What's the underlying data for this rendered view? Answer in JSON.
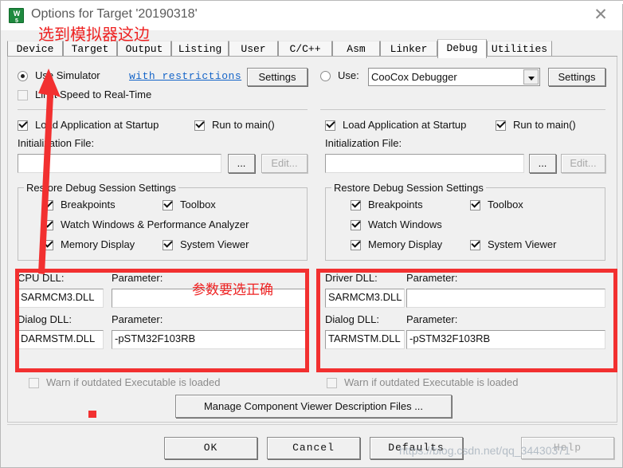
{
  "window": {
    "title": "Options for Target '20190318'",
    "icon": "uvision-icon",
    "close_label": "✕"
  },
  "tabs": [
    {
      "label": "Device",
      "selected": false
    },
    {
      "label": "Target",
      "selected": false
    },
    {
      "label": "Output",
      "selected": false
    },
    {
      "label": "Listing",
      "selected": false
    },
    {
      "label": "User",
      "selected": false
    },
    {
      "label": "C/C++",
      "selected": false
    },
    {
      "label": "Asm",
      "selected": false
    },
    {
      "label": "Linker",
      "selected": false
    },
    {
      "label": "Debug",
      "selected": true
    },
    {
      "label": "Utilities",
      "selected": false
    }
  ],
  "left_panel": {
    "use_simulator_label": "Use Simulator",
    "use_simulator_checked": true,
    "with_restrictions_link": "with restrictions",
    "settings_button": "Settings",
    "limit_speed_label": "Limit Speed to Real-Time",
    "limit_speed_checked": false,
    "load_app_label": "Load Application at Startup",
    "load_app_checked": true,
    "run_to_main_label": "Run to main()",
    "run_to_main_checked": true,
    "init_file_label": "Initialization File:",
    "init_file_value": "",
    "browse_button": "...",
    "edit_button": "Edit...",
    "restore_group_label": "Restore Debug Session Settings",
    "restore_items": [
      {
        "label": "Breakpoints",
        "checked": true
      },
      {
        "label": "Toolbox",
        "checked": true
      },
      {
        "label": "Watch Windows & Performance Analyzer",
        "checked": true
      },
      {
        "label": "Memory Display",
        "checked": true
      },
      {
        "label": "System Viewer",
        "checked": true
      }
    ],
    "cpu_dll_label": "CPU DLL:",
    "cpu_dll_value": "SARMCM3.DLL",
    "cpu_param_label": "Parameter:",
    "cpu_param_value": "",
    "dialog_dll_label": "Dialog DLL:",
    "dialog_dll_value": "DARMSTM.DLL",
    "dialog_param_label": "Parameter:",
    "dialog_param_value": "-pSTM32F103RB",
    "warn_outdated_label": "Warn if outdated Executable is loaded",
    "warn_outdated_checked": false
  },
  "right_panel": {
    "use_label": "Use:",
    "use_checked": false,
    "debugger_selected": "CooCox Debugger",
    "settings_button": "Settings",
    "load_app_label": "Load Application at Startup",
    "load_app_checked": true,
    "run_to_main_label": "Run to main()",
    "run_to_main_checked": true,
    "init_file_label": "Initialization File:",
    "init_file_value": "",
    "browse_button": "...",
    "edit_button": "Edit...",
    "restore_group_label": "Restore Debug Session Settings",
    "restore_items": [
      {
        "label": "Breakpoints",
        "checked": true
      },
      {
        "label": "Toolbox",
        "checked": true
      },
      {
        "label": "Watch Windows",
        "checked": true
      },
      {
        "label": "Memory Display",
        "checked": true
      },
      {
        "label": "System Viewer",
        "checked": true
      }
    ],
    "driver_dll_label": "Driver DLL:",
    "driver_dll_value": "SARMCM3.DLL",
    "driver_param_label": "Parameter:",
    "driver_param_value": "",
    "dialog_dll_label": "Dialog DLL:",
    "dialog_dll_value": "TARMSTM.DLL",
    "dialog_param_label": "Parameter:",
    "dialog_param_value": "-pSTM32F103RB",
    "warn_outdated_label": "Warn if outdated Executable is loaded",
    "warn_outdated_checked": false
  },
  "manage_button": "Manage Component Viewer Description Files ...",
  "footer": {
    "ok": "OK",
    "cancel": "Cancel",
    "defaults": "Defaults",
    "help": "Help"
  },
  "annotations": {
    "top_note": "选到模拟器这边",
    "param_note": "参数要选正确",
    "accent_color": "#f23030"
  },
  "watermark": "https://blog.csdn.net/qq_34430371"
}
